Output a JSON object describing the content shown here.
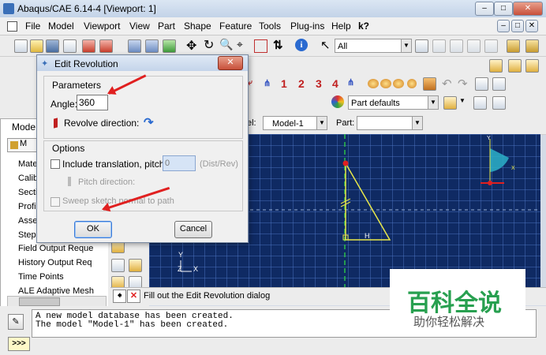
{
  "window": {
    "title": "Abaqus/CAE 6.14-4 [Viewport: 1]"
  },
  "menu": {
    "items": [
      "File",
      "Model",
      "Viewport",
      "View",
      "Part",
      "Shape",
      "Feature",
      "Tools",
      "Plug-ins",
      "Help",
      "k?"
    ]
  },
  "toolbar": {
    "selection_filter": "All",
    "numbers": [
      "1",
      "2",
      "3",
      "4"
    ],
    "part_defaults": "Part defaults",
    "model_label": "el:",
    "model_value": "Model-1",
    "part_label": "Part:"
  },
  "left_panel": {
    "tab": "Mode",
    "combo": "M",
    "items": [
      "Mate",
      "Calib",
      "Secti",
      "Profi",
      "Asse",
      "Steps",
      "Field Output Reque",
      "History Output Req",
      "Time Points",
      "ALE Adaptive Mesh"
    ]
  },
  "viewport": {
    "sketch_labels": {
      "h": "H",
      "triad_y": "Y",
      "triad_z": "Z",
      "triad_x": "X"
    },
    "mini_triad": {
      "y": "Y",
      "x": "X"
    }
  },
  "prompt": {
    "text": "Fill out the Edit Revolution dialog"
  },
  "messages": [
    "A new model database has been created.",
    "The model \"Model-1\" has been created."
  ],
  "dialog": {
    "title": "Edit Revolution",
    "parameters_label": "Parameters",
    "angle_label": "Angle:",
    "angle_value": "360",
    "revolve_direction_label": "Revolve direction:",
    "options_label": "Options",
    "include_translation_label": "Include translation, pitch:",
    "pitch_value": "0",
    "pitch_units": "(Dist/Rev)",
    "pitch_direction_label": "Pitch direction:",
    "sweep_label": "Sweep sketch normal to path",
    "ok_label": "OK",
    "cancel_label": "Cancel"
  },
  "watermark": {
    "title": "百科全说",
    "subtitle": "助你轻松解决"
  },
  "colors": {
    "accent_red": "#e02020",
    "viewport_bg": "#0f2a63",
    "grid": "#5078c8",
    "sketch_yellow": "#e8e84a"
  }
}
